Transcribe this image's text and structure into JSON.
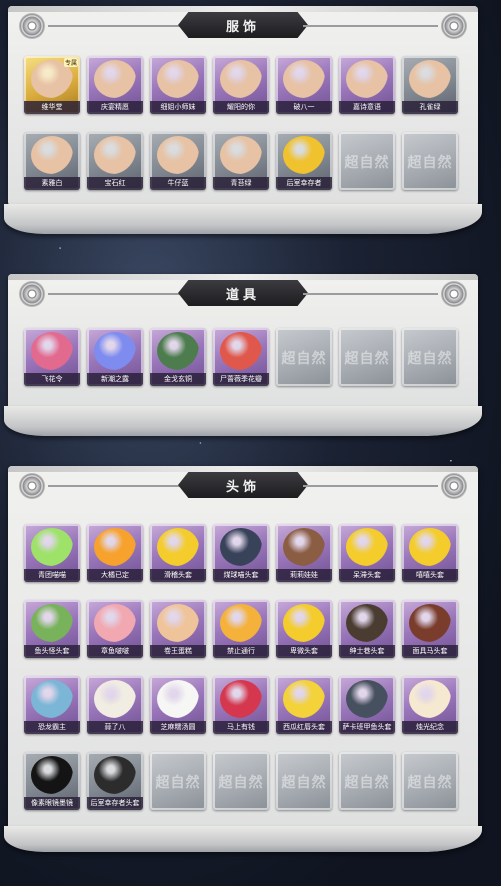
{
  "sections": [
    {
      "title": "服饰",
      "items": [
        {
          "label": "维华堂",
          "rarity": "gold",
          "icon": "costume-portrait",
          "badge": "专属"
        },
        {
          "label": "庆宴精愿",
          "rarity": "purple",
          "icon": "costume-portrait"
        },
        {
          "label": "细姐小师妹",
          "rarity": "purple",
          "icon": "costume-portrait"
        },
        {
          "label": "耀阳的你",
          "rarity": "purple",
          "icon": "costume-portrait"
        },
        {
          "label": "破八一",
          "rarity": "purple",
          "icon": "costume-portrait"
        },
        {
          "label": "嘉诗意语",
          "rarity": "purple",
          "icon": "costume-portrait"
        },
        {
          "label": "孔雀绿",
          "rarity": "grey",
          "icon": "costume-portrait"
        },
        {
          "label": "素雅白",
          "rarity": "grey",
          "icon": "costume-portrait"
        },
        {
          "label": "宝石红",
          "rarity": "grey",
          "icon": "costume-portrait"
        },
        {
          "label": "牛仔蓝",
          "rarity": "grey",
          "icon": "costume-portrait"
        },
        {
          "label": "青苔绿",
          "rarity": "grey",
          "icon": "costume-portrait"
        },
        {
          "label": "后室幸存者",
          "rarity": "grey",
          "icon": "hazmat-portrait"
        },
        {
          "label": "",
          "rarity": "empty",
          "watermark": "超自然"
        },
        {
          "label": "",
          "rarity": "empty",
          "watermark": "超自然"
        }
      ]
    },
    {
      "title": "道具",
      "items": [
        {
          "label": "飞花令",
          "rarity": "purple",
          "icon": "flower-fan"
        },
        {
          "label": "新潮之露",
          "rarity": "purple",
          "icon": "swirl-orb"
        },
        {
          "label": "金戈玄铜",
          "rarity": "purple",
          "icon": "bronze-lantern"
        },
        {
          "label": "尸蔷薇季花瓣",
          "rarity": "purple",
          "icon": "flame-bloom"
        },
        {
          "label": "",
          "rarity": "empty",
          "watermark": "超自然"
        },
        {
          "label": "",
          "rarity": "empty",
          "watermark": "超自然"
        },
        {
          "label": "",
          "rarity": "empty",
          "watermark": "超自然"
        }
      ]
    },
    {
      "title": "头饰",
      "items": [
        {
          "label": "青团喵喵",
          "rarity": "purple",
          "icon": "green-blob"
        },
        {
          "label": "大橘已定",
          "rarity": "purple",
          "icon": "orange-slice"
        },
        {
          "label": "滑稽头套",
          "rarity": "purple",
          "icon": "smirk-emoji"
        },
        {
          "label": "煤球喵头套",
          "rarity": "purple",
          "icon": "black-cat"
        },
        {
          "label": "莉莉娃娃",
          "rarity": "purple",
          "icon": "doll-head"
        },
        {
          "label": "呆滞头套",
          "rarity": "purple",
          "icon": "stare-emoji"
        },
        {
          "label": "嘻嘻头套",
          "rarity": "purple",
          "icon": "grin-emoji"
        },
        {
          "label": "鱼头怪头套",
          "rarity": "purple",
          "icon": "fish-head"
        },
        {
          "label": "章鱼啵啵",
          "rarity": "purple",
          "icon": "octopus"
        },
        {
          "label": "卷王蛋糕",
          "rarity": "purple",
          "icon": "roll-cake"
        },
        {
          "label": "禁止通行",
          "rarity": "purple",
          "icon": "traffic-cone"
        },
        {
          "label": "卑微头套",
          "rarity": "purple",
          "icon": "sad-emoji"
        },
        {
          "label": "绅士巷头套",
          "rarity": "purple",
          "icon": "dog-head"
        },
        {
          "label": "面具马头套",
          "rarity": "purple",
          "icon": "horse-head"
        },
        {
          "label": "恐龙霸主",
          "rarity": "purple",
          "icon": "dino-head"
        },
        {
          "label": "蒜了八",
          "rarity": "purple",
          "icon": "garlic"
        },
        {
          "label": "芝麻糯汤圆",
          "rarity": "purple",
          "icon": "rice-ball"
        },
        {
          "label": "马上有钱",
          "rarity": "purple",
          "icon": "red-horse"
        },
        {
          "label": "西瓜红唇头套",
          "rarity": "purple",
          "icon": "pikachu-shades"
        },
        {
          "label": "萨卡班甲鱼头套",
          "rarity": "purple",
          "icon": "fish-helmet"
        },
        {
          "label": "烛光纪念",
          "rarity": "purple",
          "icon": "candle"
        },
        {
          "label": "像素眼镜墨镜",
          "rarity": "grey",
          "icon": "pixel-shades"
        },
        {
          "label": "后室幸存者头套",
          "rarity": "grey",
          "icon": "gas-mask"
        },
        {
          "label": "",
          "rarity": "empty",
          "watermark": "超自然"
        },
        {
          "label": "",
          "rarity": "empty",
          "watermark": "超自然"
        },
        {
          "label": "",
          "rarity": "empty",
          "watermark": "超自然"
        },
        {
          "label": "",
          "rarity": "empty",
          "watermark": "超自然"
        },
        {
          "label": "",
          "rarity": "empty",
          "watermark": "超自然"
        }
      ]
    }
  ],
  "icon_colors": {
    "costume-portrait": "#e7c2a4",
    "hazmat-portrait": "#f0c22e",
    "flower-fan": "#e26a8f",
    "swirl-orb": "#7e8cf0",
    "bronze-lantern": "#4d7d4e",
    "flame-bloom": "#e0584b",
    "green-blob": "#9ee26a",
    "orange-slice": "#f7a22c",
    "smirk-emoji": "#f4cd2d",
    "black-cat": "#38435a",
    "doll-head": "#8b5d43",
    "stare-emoji": "#f4cd2d",
    "grin-emoji": "#f4cd2d",
    "fish-head": "#78b25a",
    "octopus": "#f2a8b0",
    "roll-cake": "#f0c49a",
    "traffic-cone": "#f5b23a",
    "sad-emoji": "#f4cd2d",
    "dog-head": "#4a3c30",
    "horse-head": "#7a3d2c",
    "dino-head": "#7bb6d6",
    "garlic": "#f1ede2",
    "rice-ball": "#f6f6f4",
    "red-horse": "#d5384e",
    "pikachu-shades": "#f4d23a",
    "fish-helmet": "#46505e",
    "candle": "#f6e9d2",
    "pixel-shades": "#141414",
    "gas-mask": "#2c2c2c"
  }
}
